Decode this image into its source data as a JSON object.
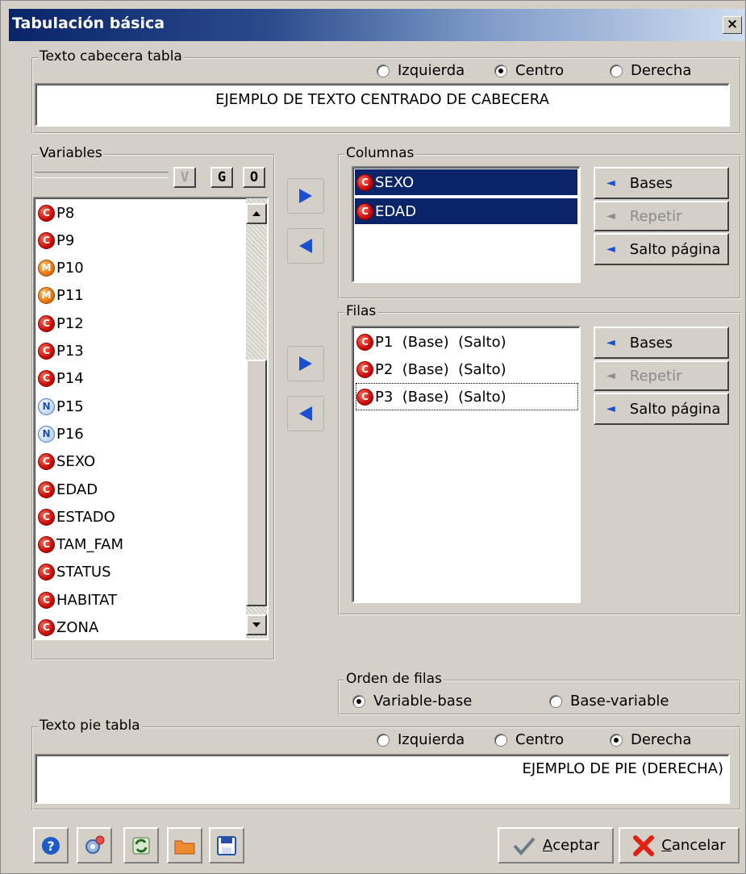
{
  "window": {
    "title": "Tabulación básica",
    "close_glyph": "×"
  },
  "header_text": {
    "group_label": "Texto cabecera tabla",
    "align_options": [
      "Izquierda",
      "Centro",
      "Derecha"
    ],
    "selected": "Centro",
    "value": "EJEMPLO DE TEXTO CENTRADO DE CABECERA"
  },
  "variables": {
    "group_label": "Variables",
    "filter_buttons": [
      "V",
      "G",
      "O"
    ],
    "items": [
      {
        "type": "C",
        "name": "P8"
      },
      {
        "type": "C",
        "name": "P9"
      },
      {
        "type": "M",
        "name": "P10"
      },
      {
        "type": "M",
        "name": "P11"
      },
      {
        "type": "C",
        "name": "P12"
      },
      {
        "type": "C",
        "name": "P13"
      },
      {
        "type": "C",
        "name": "P14"
      },
      {
        "type": "N",
        "name": "P15"
      },
      {
        "type": "N",
        "name": "P16"
      },
      {
        "type": "C",
        "name": "SEXO"
      },
      {
        "type": "C",
        "name": "EDAD"
      },
      {
        "type": "C",
        "name": "ESTADO"
      },
      {
        "type": "C",
        "name": "TAM_FAM"
      },
      {
        "type": "C",
        "name": "STATUS"
      },
      {
        "type": "C",
        "name": "HABITAT"
      },
      {
        "type": "C",
        "name": "ZONA"
      }
    ]
  },
  "columns": {
    "group_label": "Columnas",
    "items": [
      {
        "type": "C",
        "name": "SEXO"
      },
      {
        "type": "C",
        "name": "EDAD"
      }
    ],
    "buttons": {
      "bases": "Bases",
      "repeat": "Repetir",
      "page_break": "Salto página"
    }
  },
  "rows": {
    "group_label": "Filas",
    "items": [
      {
        "type": "C",
        "name": "P1  (Base)  (Salto)"
      },
      {
        "type": "C",
        "name": "P2  (Base)  (Salto)"
      },
      {
        "type": "C",
        "name": "P3  (Base)  (Salto)"
      }
    ],
    "buttons": {
      "bases": "Bases",
      "repeat": "Repetir",
      "page_break": "Salto página"
    }
  },
  "row_order": {
    "group_label": "Orden de filas",
    "options": [
      "Variable-base",
      "Base-variable"
    ],
    "selected": "Variable-base"
  },
  "footer_text": {
    "group_label": "Texto pie tabla",
    "align_options": [
      "Izquierda",
      "Centro",
      "Derecha"
    ],
    "selected": "Derecha",
    "value": "EJEMPLO DE PIE (DERECHA)"
  },
  "toolbar": {
    "icons": [
      "help-icon",
      "settings-icon",
      "refresh-icon",
      "folder-icon",
      "save-icon"
    ]
  },
  "actions": {
    "accept_first": "A",
    "accept_rest": "ceptar",
    "cancel_first": "C",
    "cancel_rest": "ancelar"
  },
  "colors": {
    "selection": "#0a246a",
    "arrow": "#1a4fd0",
    "title_start": "#0a246a"
  }
}
